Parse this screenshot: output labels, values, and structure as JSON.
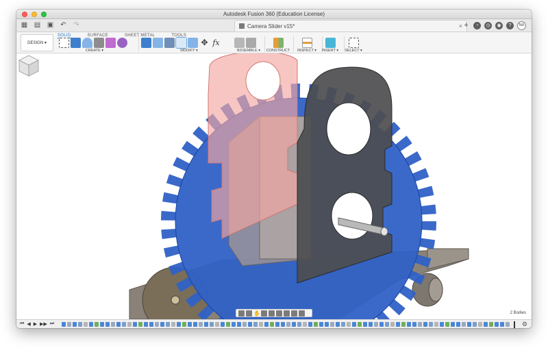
{
  "window": {
    "title": "Autodesk Fusion 360 (Education License)"
  },
  "quick_access": {
    "document_tab": "Camera Slider v15*",
    "close_tab": "×",
    "new_tab": "+",
    "user_initials": "NA"
  },
  "ribbon": {
    "workspace_button": "DESIGN ▾",
    "tabs": [
      {
        "label": "SOLID",
        "active": true
      },
      {
        "label": "SURFACE",
        "active": false
      },
      {
        "label": "SHEET METAL",
        "active": false
      },
      {
        "label": "TOOLS",
        "active": false
      }
    ],
    "groups": {
      "create": "CREATE ▾",
      "modify": "MODIFY ▾",
      "assemble": "ASSEMBLE ▾",
      "construct": "CONSTRUCT ▾",
      "inspect": "INSPECT ▾",
      "insert": "INSERT ▾",
      "select": "SELECT ▾"
    },
    "fx_label": "fx"
  },
  "viewport": {
    "bodies_count": "2 Bodies",
    "colors": {
      "gear": "#2f61c6",
      "dark_plate": "#4d4d4f",
      "pink_plate": "#f4a7a2",
      "base_plate": "#8a8278",
      "accent_blue": "#1a73c9"
    }
  },
  "timeline": {
    "controls": [
      "⏮",
      "◀",
      "▶",
      "▶▶",
      "⏭"
    ],
    "settings_icon": "⚙"
  }
}
